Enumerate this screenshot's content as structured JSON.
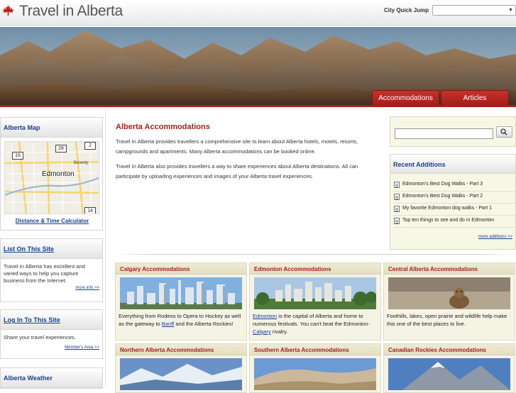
{
  "header": {
    "site_title": "Travel in Alberta",
    "city_jump_label": "City Quick Jump",
    "city_jump_value": ""
  },
  "tabs": [
    {
      "label": "Accommodations"
    },
    {
      "label": "Articles"
    }
  ],
  "sidebar": {
    "map_title": "Alberta Map",
    "map_labels": {
      "city": "Edmonton",
      "place": "Beverly",
      "road1": "16",
      "road2": "28",
      "road3": "14",
      "road4": "2"
    },
    "calc_link": "Distance & Time Calculator",
    "list_title": "List On This Site",
    "list_text": "Travel In Alberta has excellent and varied ways to help you capture business from the Internet.",
    "list_more": "more info >>",
    "login_title": "Log In To This Site",
    "login_text": "Share your travel experiences.",
    "login_more": "Member's Area >>",
    "weather_title": "Alberta Weather"
  },
  "main": {
    "title": "Alberta Accommodations",
    "para1": "Travel In Alberta provides travellers a comprehensive site to learn about Alberta hotels, motels, resorts, campgrounds and apartments. Many Alberta accommodations can be booked online.",
    "para2": "Travel In Alberta also provides travellers a way to share experiences about Alberta destinations. All can participate by uploading experiences and images of your Alberta travel experiences."
  },
  "search": {
    "placeholder": ""
  },
  "recent": {
    "title": "Recent Additions",
    "items": [
      "Edmonton's Best Dog Walks - Part 3",
      "Edmonton's Best Dog Walks - Part 2",
      "My favorite Edmonton dog walks - Part 1",
      "Top ten things to see and do in Edmonton"
    ],
    "more": "more additions >>"
  },
  "cards": [
    {
      "title": "Calgary Accommodations",
      "text_a": "Everything from Rodeos to Opera to Hockey as well as the gateway to ",
      "link": "Banff",
      "text_b": " and the Alberta Rockies!"
    },
    {
      "title": "Edmonton Accommodations",
      "link": "Edmonton",
      "text_a": " is the capital of Alberta and home to numerous festivals. You can't beat the Edmonton-",
      "link2": "Calgary",
      "text_b": " rivalry."
    },
    {
      "title": "Central Alberta Accommodations",
      "text_a": "Foothills, lakes, open prairie and wildlife help make this one of the best places to live."
    },
    {
      "title": "Northern Alberta Accommodations"
    },
    {
      "title": "Southern Alberta Accommodations"
    },
    {
      "title": "Canadian Rockies Accommodations"
    }
  ],
  "colors": {
    "brand_red": "#a6201c",
    "link_blue": "#1a3f8f",
    "panel_beige": "#f5f3e4"
  }
}
